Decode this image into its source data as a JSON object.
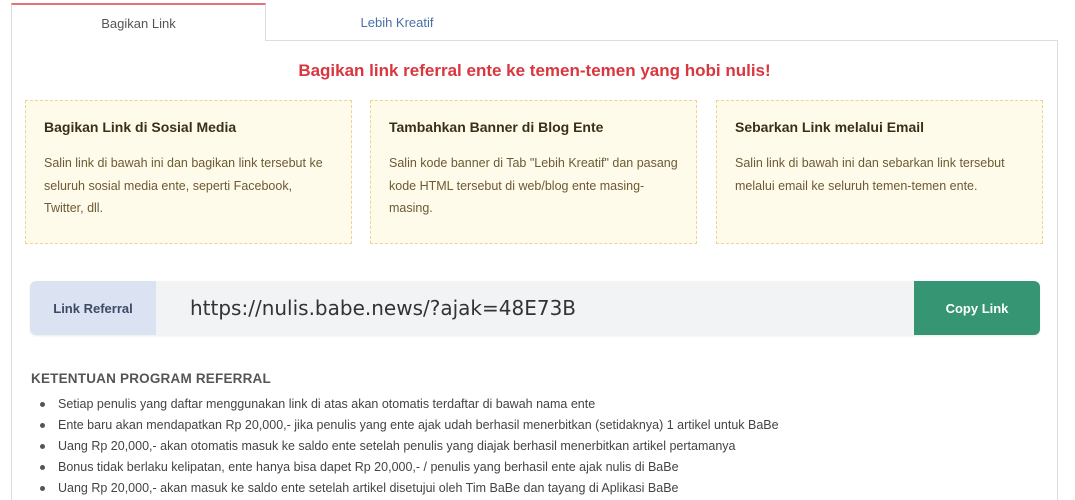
{
  "tabs": [
    {
      "label": "Bagikan Link"
    },
    {
      "label": "Lebih Kreatif"
    }
  ],
  "headline": "Bagikan link referral ente ke temen-temen yang hobi nulis!",
  "cards": [
    {
      "title": "Bagikan Link di Sosial Media",
      "text": "Salin link di bawah ini dan bagikan link tersebut ke seluruh sosial media ente, seperti Facebook, Twitter, dll."
    },
    {
      "title": "Tambahkan Banner di Blog Ente",
      "text": "Salin kode banner di Tab \"Lebih Kreatif\" dan pasang kode HTML tersebut di web/blog ente masing-masing."
    },
    {
      "title": "Sebarkan Link melalui Email",
      "text": "Salin link di bawah ini dan sebarkan link tersebut melalui email ke seluruh temen-temen ente."
    }
  ],
  "referral": {
    "label": "Link Referral",
    "url": "https://nulis.babe.news/?ajak=48E73B",
    "copy_label": "Copy Link"
  },
  "terms": {
    "title": "KETENTUAN PROGRAM REFERRAL",
    "items": [
      "Setiap penulis yang daftar menggunakan link di atas akan otomatis terdaftar di bawah nama ente",
      "Ente baru akan mendapatkan Rp 20,000,- jika penulis yang ente ajak udah berhasil menerbitkan (setidaknya) 1 artikel untuk BaBe",
      "Uang Rp 20,000,- akan otomatis masuk ke saldo ente setelah penulis yang diajak berhasil menerbitkan artikel pertamanya",
      "Bonus tidak berlaku kelipatan, ente hanya bisa dapet Rp 20,000,- / penulis yang berhasil ente ajak nulis di BaBe",
      "Uang Rp 20,000,- akan masuk ke saldo ente setelah artikel disetujui oleh Tim BaBe dan tayang di Aplikasi BaBe"
    ]
  },
  "colors": {
    "headline": "#d9363e",
    "card_bg": "#fffbea",
    "card_border": "#ecd396",
    "copy_button": "#369674",
    "label_bg": "#dbe3f2"
  }
}
